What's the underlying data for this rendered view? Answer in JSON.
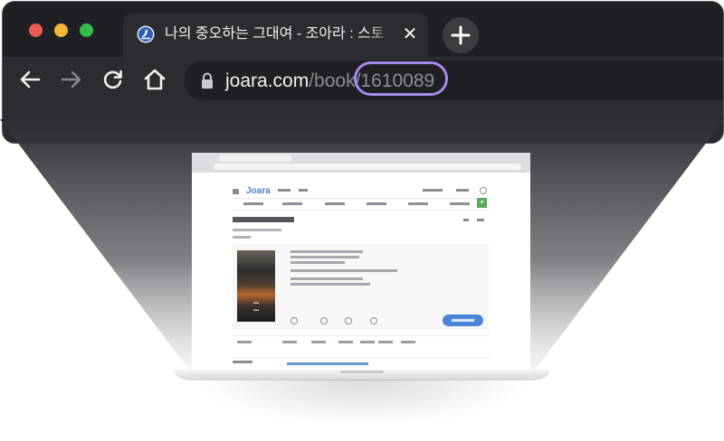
{
  "browser": {
    "tab": {
      "title": "나의 중오하는 그대여 - 조아라 : 스토",
      "favicon": "joara-favicon-icon",
      "close_icon": "close-icon"
    },
    "new_tab_icon": "plus-icon",
    "toolbar": {
      "back_icon": "back-arrow-icon",
      "forward_icon": "forward-arrow-icon",
      "reload_icon": "reload-icon",
      "home_icon": "home-icon"
    },
    "address_bar": {
      "lock_icon": "lock-icon",
      "domain": "joara.com",
      "path": "/book/",
      "book_id": "1610089"
    }
  },
  "colors": {
    "highlight": "#a98bf0",
    "browser_bg": "#2b2c30",
    "tabstrip_bg": "#1f2023",
    "beam": "#2d2f34",
    "read_button": "#4a85d8"
  },
  "preview": {
    "page_logo": "Joara",
    "plus_icon": "plus-icon"
  }
}
